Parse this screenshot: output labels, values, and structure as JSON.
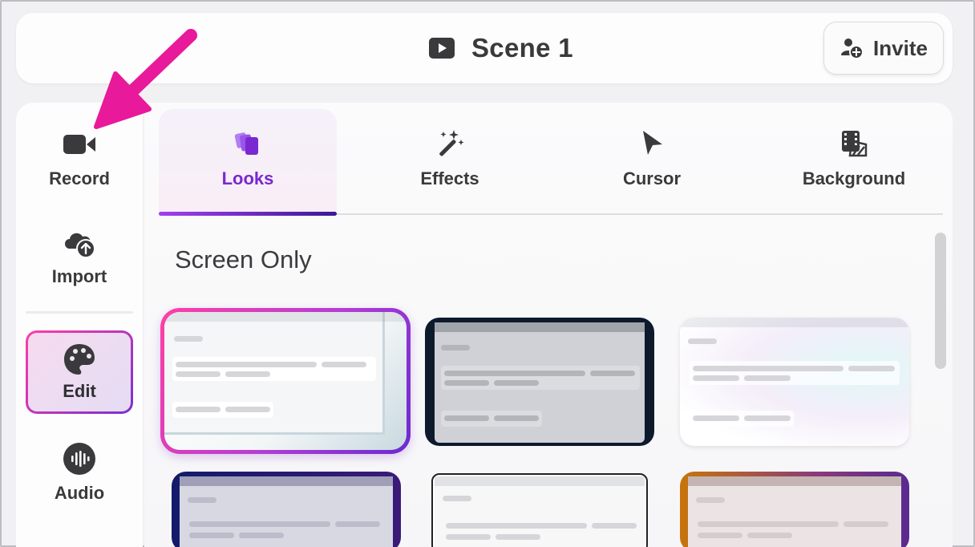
{
  "header": {
    "title": "Scene 1",
    "invite_label": "Invite"
  },
  "sidebar": {
    "items": [
      {
        "label": "Record",
        "icon": "video-camera-icon"
      },
      {
        "label": "Import",
        "icon": "cloud-upload-icon"
      },
      {
        "label": "Edit",
        "icon": "palette-icon",
        "active": true
      },
      {
        "label": "Audio",
        "icon": "audio-waveform-icon"
      }
    ]
  },
  "tabs": [
    {
      "label": "Looks",
      "icon": "layers-icon",
      "active": true
    },
    {
      "label": "Effects",
      "icon": "magic-wand-icon"
    },
    {
      "label": "Cursor",
      "icon": "pointer-icon"
    },
    {
      "label": "Background",
      "icon": "film-strip-icon"
    }
  ],
  "section": {
    "title": "Screen Only"
  },
  "looks": [
    {
      "style": "light-gradient-frame",
      "selected": true
    },
    {
      "style": "dark-frame"
    },
    {
      "style": "light-glow"
    },
    {
      "style": "navy-frame"
    },
    {
      "style": "black-outline"
    },
    {
      "style": "amber-purple-frame"
    }
  ],
  "colors": {
    "accent": "#7a28cf",
    "accent_pink": "#ff3ea5",
    "annotation_arrow": "#e8199b"
  }
}
